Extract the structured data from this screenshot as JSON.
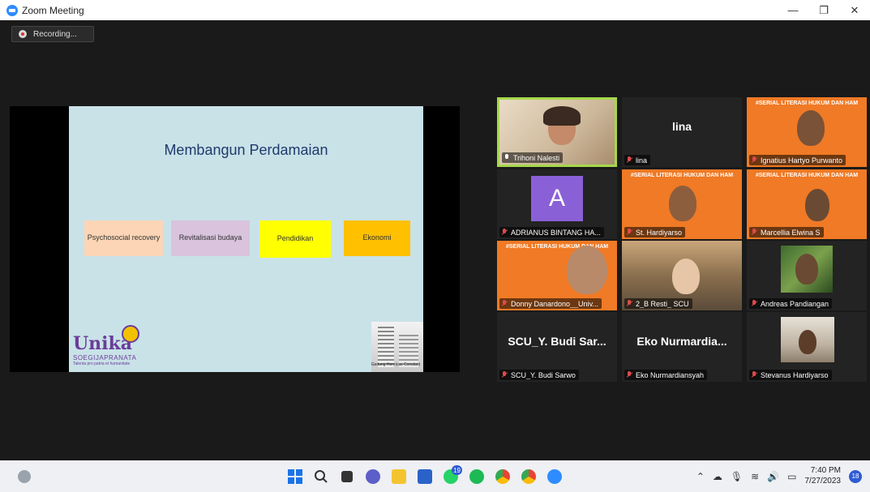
{
  "window": {
    "title": "Zoom Meeting",
    "controls": {
      "minimize": "—",
      "restore": "❐",
      "close": "✕"
    }
  },
  "recording": {
    "label": "Recording..."
  },
  "slide": {
    "title": "Membangun Perdamaian",
    "boxes": [
      {
        "label": "Psychosocial recovery",
        "color": "#fbd5b5"
      },
      {
        "label": "Revitalisasi budaya",
        "color": "#d9c3dd"
      },
      {
        "label": "Pendidikan",
        "color": "#ffff00"
      },
      {
        "label": "Ekonomi",
        "color": "#ffc000"
      }
    ],
    "logo_name": "Unika",
    "logo_sub": "SOEGIJAPRANATA",
    "logo_tagline": "Talenta pro patria et humanitate",
    "caption": "Gedung Henricus Constant"
  },
  "participants": [
    {
      "name": "Trihoni Nalesti",
      "big_label": "",
      "muted": false,
      "active": true
    },
    {
      "name": "lina",
      "big_label": "lina",
      "muted": true,
      "active": false
    },
    {
      "name": "Ignatius Hartyo Purwanto",
      "big_label": "",
      "muted": true,
      "active": false
    },
    {
      "name": "ADRIANUS BINTANG HA...",
      "big_label": "",
      "avatar_letter": "A",
      "muted": true,
      "active": false
    },
    {
      "name": "St. Hardiyarso",
      "big_label": "",
      "muted": true,
      "active": false
    },
    {
      "name": "Marcellia Elwina S",
      "big_label": "",
      "muted": true,
      "active": false
    },
    {
      "name": "Donny Danardono__Univ...",
      "big_label": "",
      "muted": true,
      "active": false
    },
    {
      "name": "2_B Resti_ SCU",
      "big_label": "",
      "muted": true,
      "active": false
    },
    {
      "name": "Andreas Pandiangan",
      "big_label": "",
      "muted": true,
      "active": false
    },
    {
      "name": "SCU_Y. Budi Sarwo",
      "big_label": "SCU_Y. Budi Sar...",
      "muted": true,
      "active": false
    },
    {
      "name": "Eko Nurmardiansyah",
      "big_label": "Eko Nurmardia...",
      "muted": true,
      "active": false
    },
    {
      "name": "Stevanus Hardiyarso",
      "big_label": "",
      "muted": true,
      "active": false
    }
  ],
  "banner_text": "#SERIAL LITERASI HUKUM DAN HAM",
  "taskbar": {
    "whatsapp_badge": "19",
    "time": "7:40 PM",
    "date": "7/27/2023",
    "notifications": "18"
  }
}
